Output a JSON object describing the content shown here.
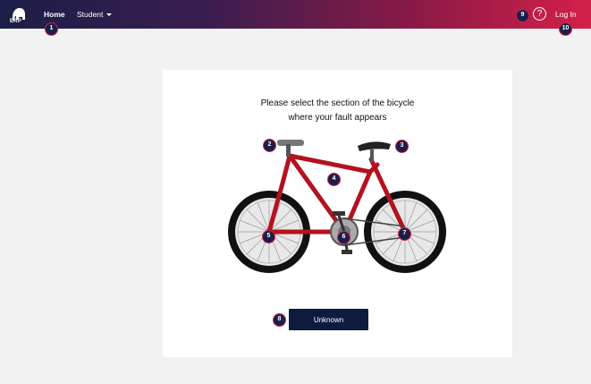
{
  "nav": {
    "logo_text": "ERP",
    "home": "Home",
    "student": "Student",
    "help": "?",
    "login": "Log In"
  },
  "prompt": {
    "line1": "Please select the section of the bicycle",
    "line2": "where your fault appears"
  },
  "unknown_button": "Unknown",
  "markers": {
    "m1": "1",
    "m2": "2",
    "m3": "3",
    "m4": "4",
    "m5": "5",
    "m6": "6",
    "m7": "7",
    "m8": "8",
    "m9": "9",
    "m10": "10"
  },
  "colors": {
    "nav_start": "#1b1f47",
    "nav_end": "#d4204a",
    "button": "#0f1a3f",
    "frame": "#b3121e"
  }
}
